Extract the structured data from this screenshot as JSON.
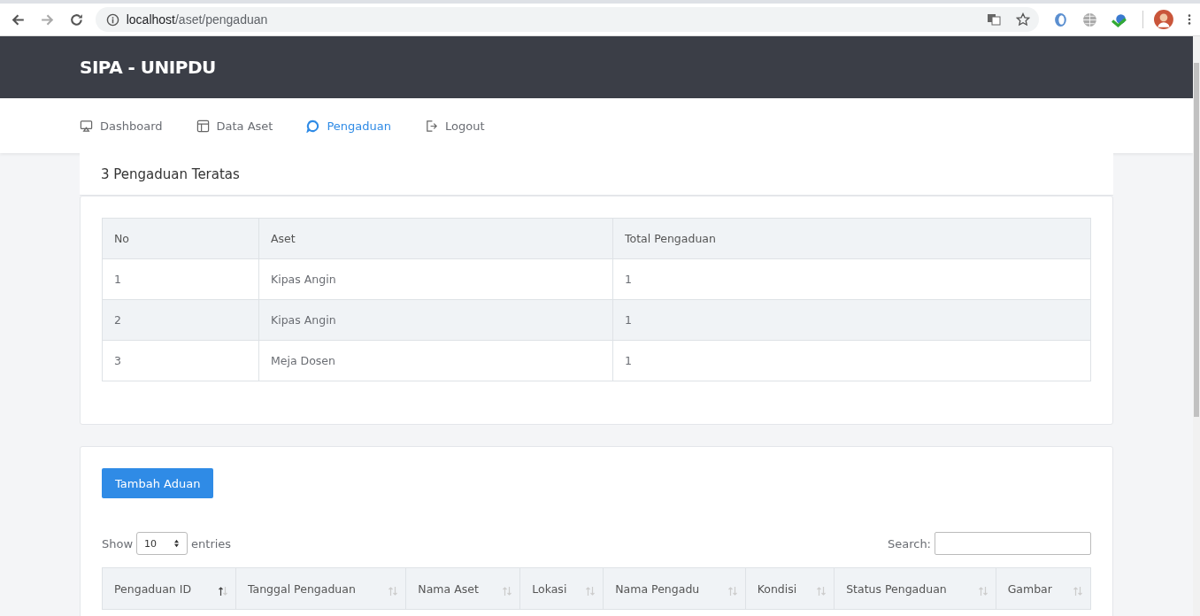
{
  "browser": {
    "url_host": "localhost",
    "url_path": "/aset/pengaduan"
  },
  "header": {
    "brand": "SIPA - UNIPDU"
  },
  "nav": [
    {
      "label": "Dashboard",
      "selected": false
    },
    {
      "label": "Data Aset",
      "selected": false
    },
    {
      "label": "Pengaduan",
      "selected": true
    },
    {
      "label": "Logout",
      "selected": false
    }
  ],
  "top_card": {
    "title": "3 Pengaduan Teratas",
    "columns": [
      "No",
      "Aset",
      "Total Pengaduan"
    ],
    "rows": [
      [
        "1",
        "Kipas Angin",
        "1"
      ],
      [
        "2",
        "Kipas Angin",
        "1"
      ],
      [
        "3",
        "Meja Dosen",
        "1"
      ]
    ]
  },
  "main_card": {
    "add_button": "Tambah Aduan",
    "show_label": "Show",
    "page_size": "10",
    "entries_label": "entries",
    "search_label": "Search:",
    "columns": [
      {
        "label": "Pengaduan ID",
        "sorted": true
      },
      {
        "label": "Tanggal Pengaduan",
        "sorted": false
      },
      {
        "label": "Nama Aset",
        "sorted": false
      },
      {
        "label": "Lokasi",
        "sorted": false
      },
      {
        "label": "Nama Pengadu",
        "sorted": false
      },
      {
        "label": "Kondisi",
        "sorted": false
      },
      {
        "label": "Status Pengaduan",
        "sorted": false
      },
      {
        "label": "Gambar",
        "sorted": false
      }
    ]
  }
}
